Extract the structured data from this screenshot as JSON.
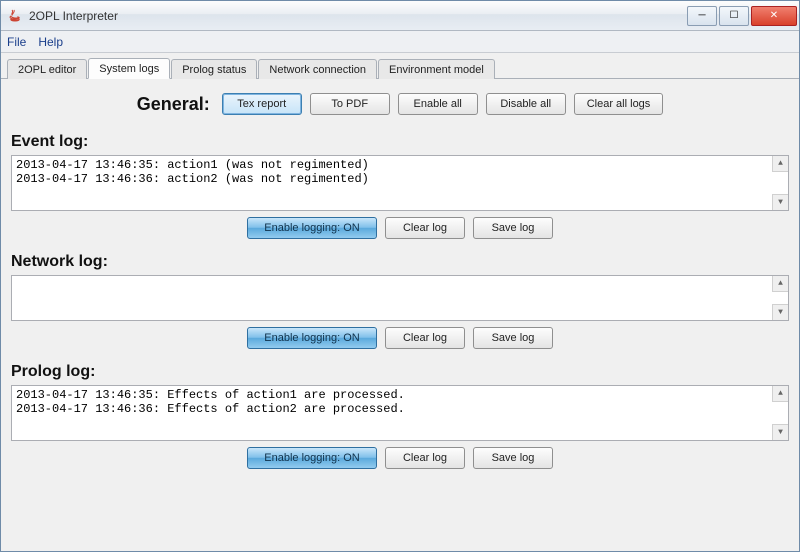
{
  "window": {
    "title": "2OPL Interpreter"
  },
  "menu": {
    "file": "File",
    "help": "Help"
  },
  "tabs": {
    "editor": "2OPL editor",
    "system_logs": "System logs",
    "prolog_status": "Prolog status",
    "network_connection": "Network connection",
    "environment_model": "Environment model"
  },
  "general": {
    "label": "General:",
    "tex_report": "Tex report",
    "to_pdf": "To PDF",
    "enable_all": "Enable all",
    "disable_all": "Disable all",
    "clear_all": "Clear all logs"
  },
  "event_log": {
    "title": "Event log:",
    "content": "2013-04-17 13:46:35: action1 (was not regimented)\n2013-04-17 13:46:36: action2 (was not regimented)",
    "toggle": "Enable logging:  ON",
    "clear": "Clear log",
    "save": "Save log"
  },
  "network_log": {
    "title": "Network log:",
    "content": "",
    "toggle": "Enable logging:  ON",
    "clear": "Clear log",
    "save": "Save log"
  },
  "prolog_log": {
    "title": "Prolog log:",
    "content": "2013-04-17 13:46:35: Effects of action1 are processed.\n2013-04-17 13:46:36: Effects of action2 are processed.",
    "toggle": "Enable logging:  ON",
    "clear": "Clear log",
    "save": "Save log"
  }
}
